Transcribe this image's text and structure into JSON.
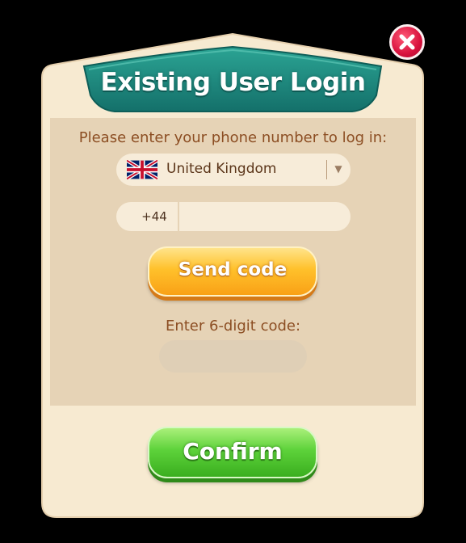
{
  "dialog": {
    "title": "Existing User Login",
    "prompt": "Please enter your phone number to log in:",
    "country": {
      "selected": "United Kingdom",
      "flag_icon": "uk-flag-icon",
      "dropdown_icon": "chevron-down-icon"
    },
    "phone": {
      "prefix": "+44",
      "value": ""
    },
    "send_code_label": "Send code",
    "code_label": "Enter 6-digit code:",
    "code_value": "",
    "confirm_label": "Confirm",
    "close_icon": "close-icon"
  },
  "colors": {
    "banner": "#1e8c80",
    "panel_border": "#f7ead1",
    "panel_inner": "#e6d3b6",
    "text_brown": "#8c4e23",
    "send_button": "#ffc12b",
    "confirm_button": "#5dd23a",
    "close_button": "#d8123e"
  }
}
